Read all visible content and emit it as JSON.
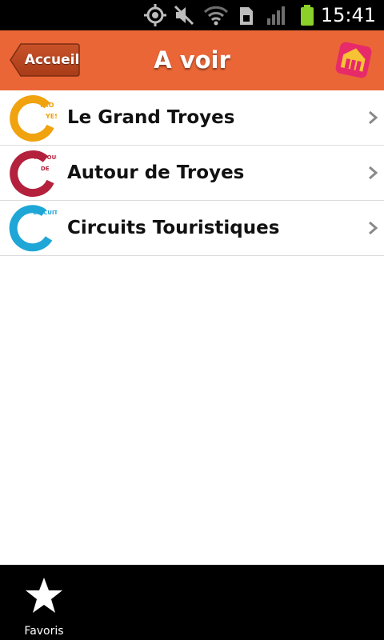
{
  "status_bar": {
    "time": "15:41",
    "icons": [
      "gps-icon",
      "mute-icon",
      "wifi-icon",
      "sim-icon",
      "signal-icon",
      "battery-icon"
    ],
    "battery_color": "#8bd12a"
  },
  "header": {
    "back_label": "Accueil",
    "title": "A voir",
    "background": "#ea6636"
  },
  "list": {
    "items": [
      {
        "label": "Le Grand Troyes",
        "logo_text": "TROYES",
        "logo_color": "#f0a20f",
        "icon": "chevron-right-icon"
      },
      {
        "label": "Autour de Troyes",
        "logo_text": "AUTOUR DE TROYES",
        "logo_color": "#b3213d",
        "icon": "chevron-right-icon"
      },
      {
        "label": "Circuits Touristiques",
        "logo_text": "CIRCUITS TOURISTIQUES",
        "logo_color": "#1ea6d6",
        "icon": "chevron-right-icon"
      }
    ]
  },
  "bottom_bar": {
    "favorites_label": "Favoris"
  }
}
